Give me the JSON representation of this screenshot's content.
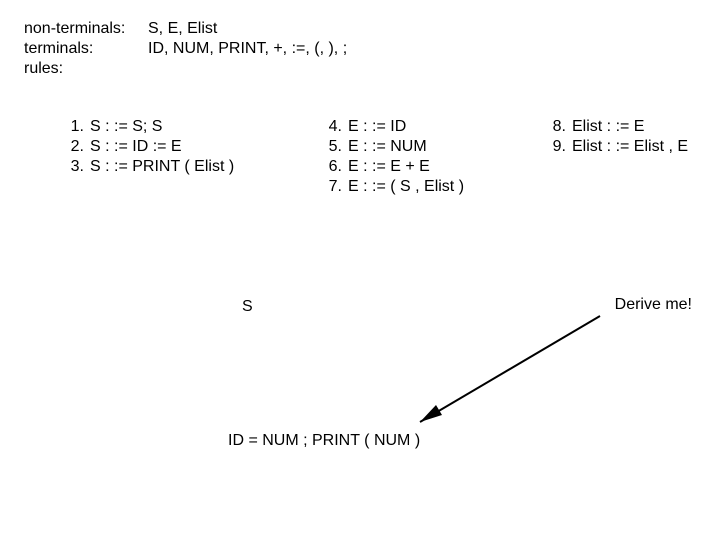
{
  "defs": {
    "nonterminals_label": "non-terminals:",
    "nonterminals_value": "S, E, Elist",
    "terminals_label": "terminals:",
    "terminals_value": "ID, NUM, PRINT, +, :=, (, ), ;",
    "rules_label": "rules:"
  },
  "rules_col1": [
    {
      "n": "1.",
      "body": "S : := S; S"
    },
    {
      "n": "2.",
      "body": "S : := ID := E"
    },
    {
      "n": "3.",
      "body": "S : := PRINT ( Elist )"
    }
  ],
  "rules_col2": [
    {
      "n": "4.",
      "body": "E : := ID"
    },
    {
      "n": "5.",
      "body": "E : := NUM"
    },
    {
      "n": "6.",
      "body": "E : := E + E"
    },
    {
      "n": "7.",
      "body": "E : := ( S , Elist )"
    }
  ],
  "rules_col3": [
    {
      "n": "8.",
      "body": "Elist : := E"
    },
    {
      "n": "9.",
      "body": "Elist : := Elist , E"
    }
  ],
  "start_symbol": "S",
  "derive_label": "Derive me!",
  "target_string": "ID = NUM ; PRINT ( NUM )"
}
